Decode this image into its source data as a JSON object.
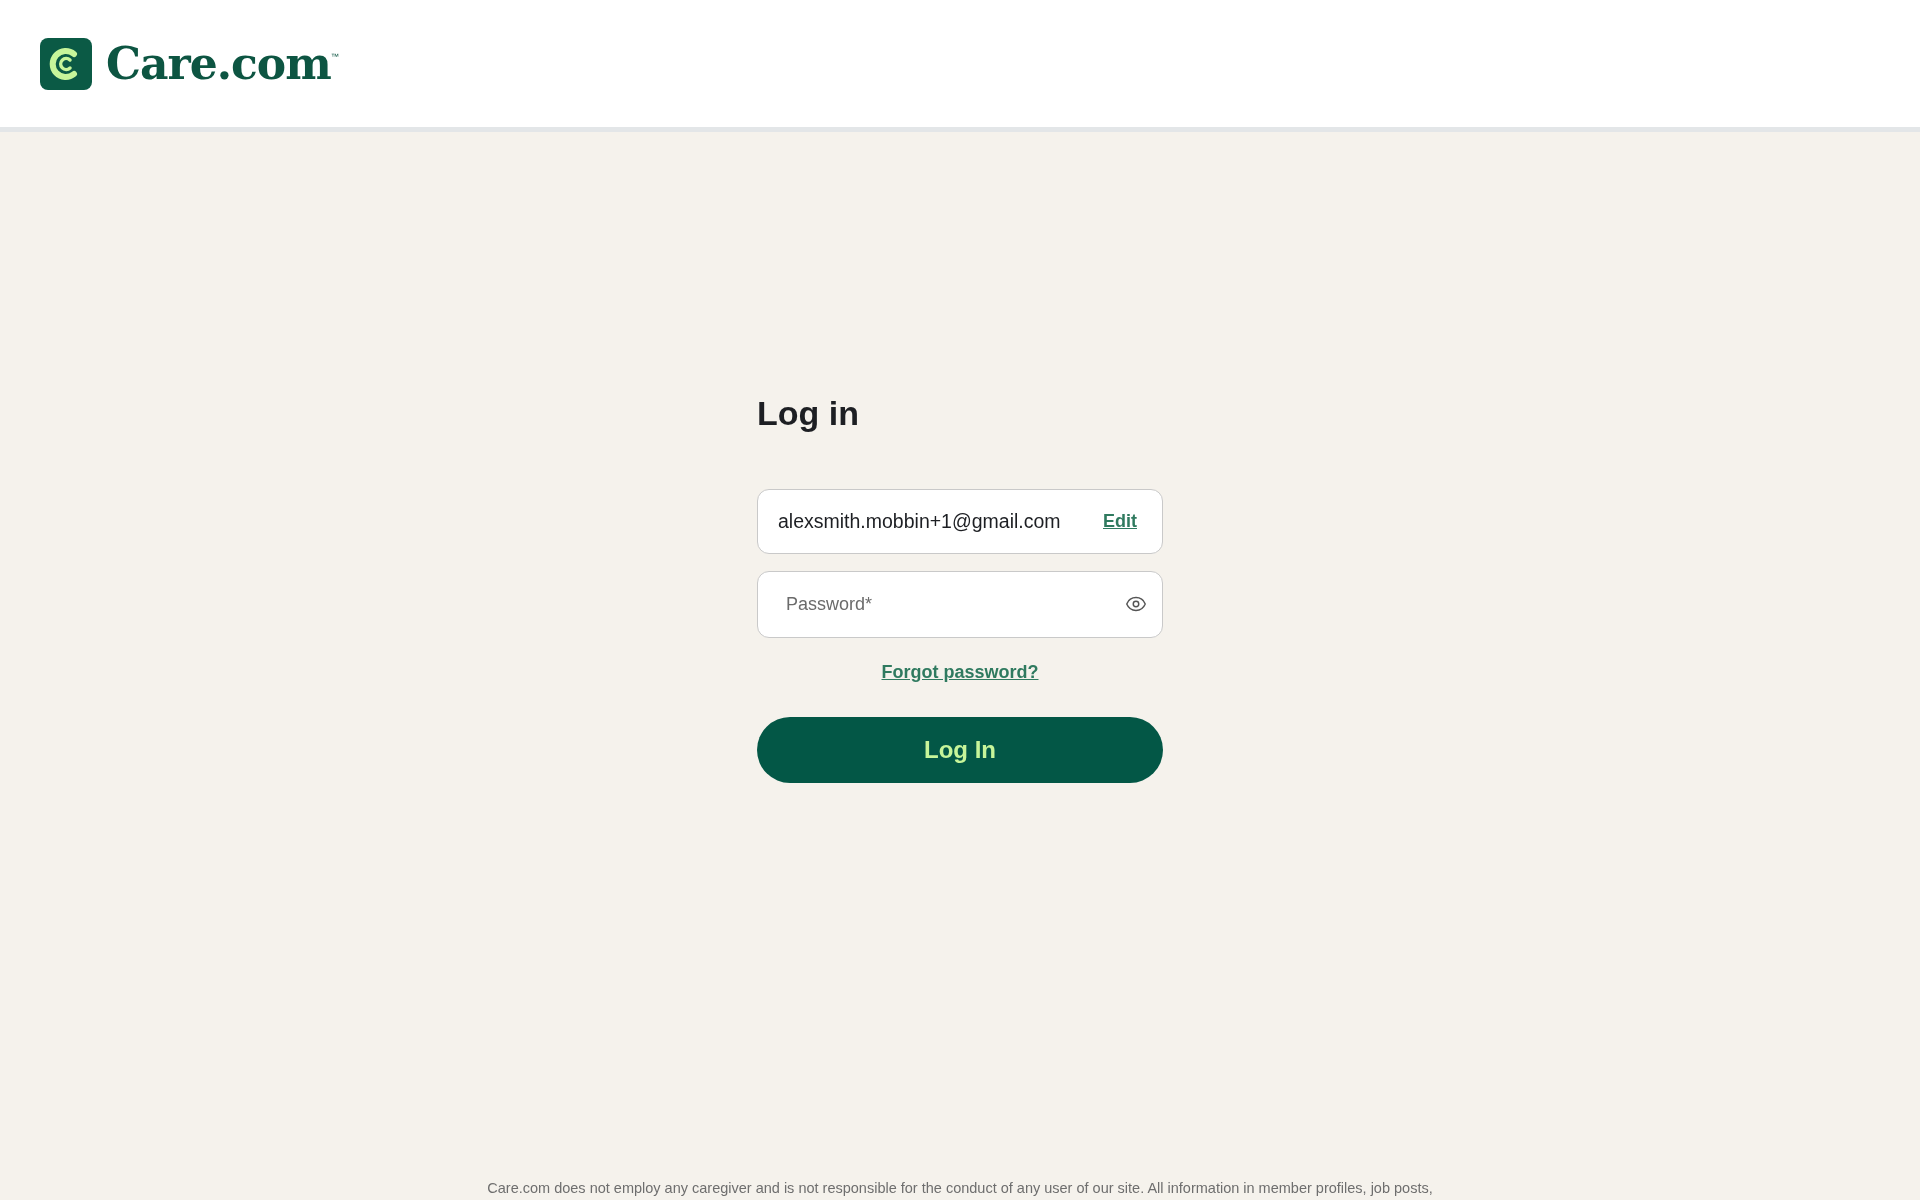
{
  "header": {
    "logo_text": "Care.com",
    "logo_mark": "™"
  },
  "login": {
    "title": "Log in",
    "email": {
      "value": "alexsmith.mobbin+1@gmail.com",
      "action": "Edit"
    },
    "password": {
      "placeholder": "Password*"
    },
    "forgot_link": "Forgot password?",
    "submit": "Log In"
  },
  "footer": {
    "disclaimer": "Care.com does not employ any caregiver and is not responsible for the conduct of any user of our site. All information in member profiles, job posts,"
  }
}
